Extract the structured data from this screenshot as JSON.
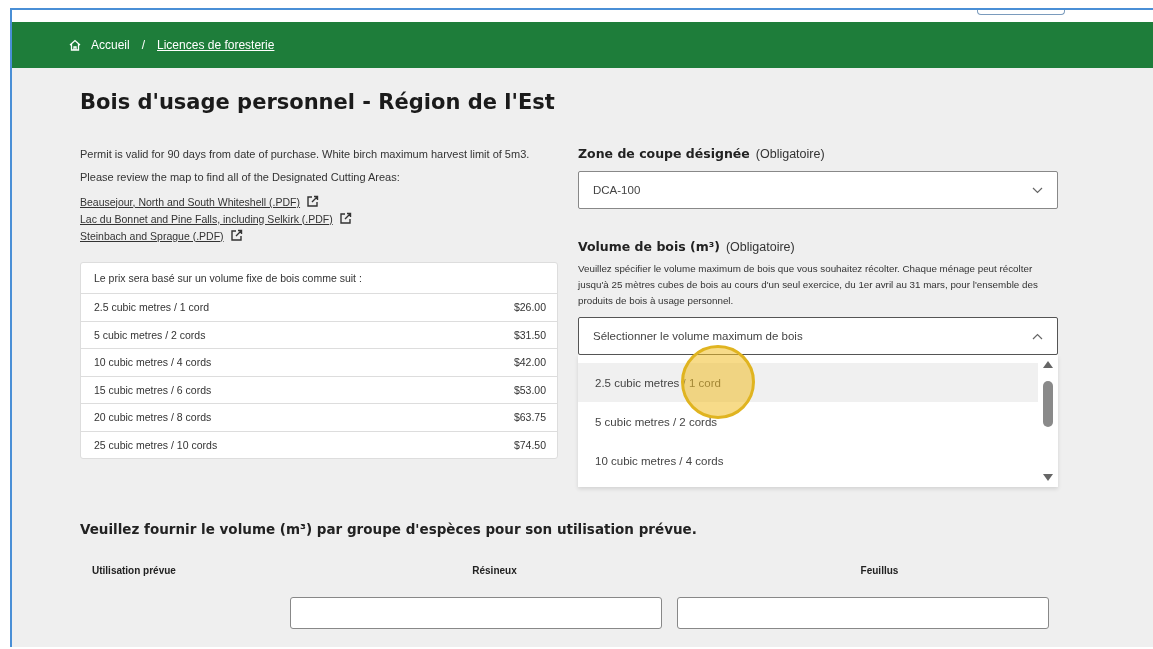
{
  "breadcrumb_separator": "/",
  "breadcrumb": [
    {
      "label": "Accueil",
      "kind": "home"
    },
    {
      "label": "Licences de foresterie",
      "kind": "link"
    }
  ],
  "title": "Bois d'usage personnel - Région de l'Est",
  "intro": [
    "Permit is valid for 90 days from date of purchase. White birch maximum harvest limit of 5m3.",
    "Please review the map to find all of the Designated Cutting Areas:"
  ],
  "map_links": [
    "Beausejour, North and South Whiteshell (.PDF)",
    "Lac du Bonnet and Pine Falls, including Selkirk (.PDF)",
    "Steinbach and Sprague (.PDF)"
  ],
  "price_table": {
    "caption": "Le prix sera basé sur un volume fixe de bois comme suit :",
    "rows": [
      {
        "volume": "2.5 cubic metres / 1 cord",
        "price": "$26.00"
      },
      {
        "volume": "5 cubic metres / 2 cords",
        "price": "$31.50"
      },
      {
        "volume": "10 cubic metres / 4 cords",
        "price": "$42.00"
      },
      {
        "volume": "15 cubic metres / 6 cords",
        "price": "$53.00"
      },
      {
        "volume": "20 cubic metres / 8 cords",
        "price": "$63.75"
      },
      {
        "volume": "25 cubic metres / 10 cords",
        "price": "$74.50"
      }
    ]
  },
  "zone_field": {
    "label": "Zone de coupe désignée",
    "required": "(Obligatoire)",
    "value": "DCA-100",
    "expanded": false
  },
  "volume_field": {
    "label": "Volume de bois (m³)",
    "required": "(Obligatoire)",
    "help": "Veuillez spécifier le volume maximum de bois que vous souhaitez récolter. Chaque ménage peut récolter jusqu'à 25 mètres cubes de bois au cours d'un seul exercice, du 1er avril au 31 mars, pour l'ensemble des produits de bois à usage personnel.",
    "placeholder": "Sélectionner le volume maximum de bois",
    "expanded": true,
    "options": [
      {
        "label": "2.5 cubic metres / 1 cord",
        "selected": true
      },
      {
        "label": "5 cubic metres / 2 cords",
        "selected": false
      },
      {
        "label": "10 cubic metres / 4 cords",
        "selected": false
      }
    ]
  },
  "species_section": {
    "heading": "Veuillez fournir le volume (m³) par groupe d'espèces pour son utilisation prévue.",
    "columns": [
      "Utilisation prévue",
      "Résineux",
      "Feuillus"
    ]
  }
}
